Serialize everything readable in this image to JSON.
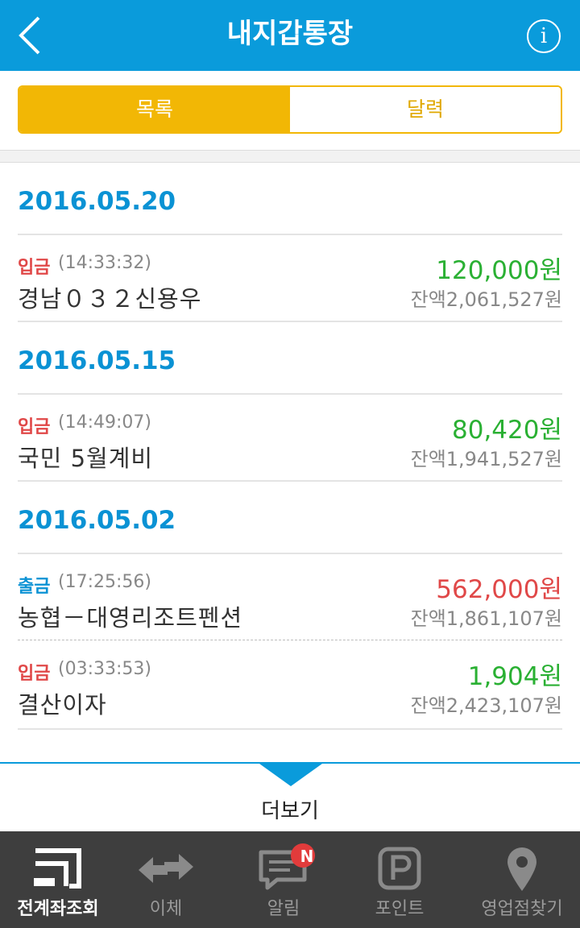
{
  "header": {
    "title": "내지갑통장",
    "info": "i"
  },
  "segment": {
    "list": "목록",
    "calendar": "달력"
  },
  "groups": [
    {
      "date": "2016.05.20",
      "items": [
        {
          "type": "입금",
          "kind": "in",
          "time": "(14:33:32)",
          "desc": "경남０３２신용우",
          "amount": "120,000원",
          "amount_color": "green",
          "balance": "잔액2,061,527원"
        }
      ]
    },
    {
      "date": "2016.05.15",
      "items": [
        {
          "type": "입금",
          "kind": "in",
          "time": "(14:49:07)",
          "desc": "국민 5월계비",
          "amount": "80,420원",
          "amount_color": "green",
          "balance": "잔액1,941,527원"
        }
      ]
    },
    {
      "date": "2016.05.02",
      "items": [
        {
          "type": "출금",
          "kind": "out",
          "time": "(17:25:56)",
          "desc": "농협－대영리조트펜션",
          "amount": "562,000원",
          "amount_color": "red",
          "balance": "잔액1,861,107원"
        },
        {
          "type": "입금",
          "kind": "in",
          "time": "(03:33:53)",
          "desc": "결산이자",
          "amount": "1,904원",
          "amount_color": "green",
          "balance": "잔액2,423,107원"
        }
      ]
    }
  ],
  "more": "더보기",
  "tabs": [
    {
      "label": "전계좌조회",
      "icon": "account-icon",
      "selected": true
    },
    {
      "label": "이체",
      "icon": "transfer-icon"
    },
    {
      "label": "알림",
      "icon": "message-icon",
      "badge": "N"
    },
    {
      "label": "포인트",
      "icon": "point-icon"
    },
    {
      "label": "영업점찾기",
      "icon": "location-icon"
    }
  ],
  "colors": {
    "primary": "#0a9bdb",
    "segment": "#f2b705",
    "deposit": "#e04848",
    "withdraw": "#0a92d4",
    "amount_in": "#2ab033",
    "amount_out": "#e04848"
  }
}
